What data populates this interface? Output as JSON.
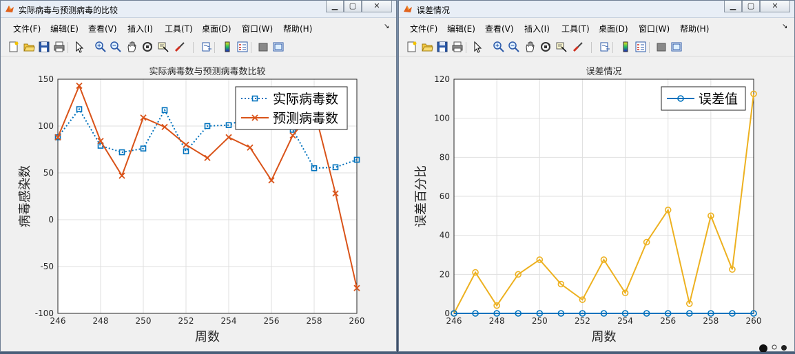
{
  "colors": {
    "accent_blue": "#0072bd",
    "accent_red": "#d95319",
    "accent_yellow": "#edb120",
    "grid": "#dfdfdf"
  },
  "window1": {
    "title": "实际病毒与预测病毒的比较",
    "menus": [
      "文件(F)",
      "编辑(E)",
      "查看(V)",
      "插入(I)",
      "工具(T)",
      "桌面(D)",
      "窗口(W)",
      "帮助(H)"
    ]
  },
  "window2": {
    "title": "误差情况",
    "menus": [
      "文件(F)",
      "编辑(E)",
      "查看(V)",
      "插入(I)",
      "工具(T)",
      "桌面(D)",
      "窗口(W)",
      "帮助(H)"
    ]
  },
  "toolbar_icons": [
    "new-figure-icon",
    "open-file-icon",
    "save-icon",
    "print-icon",
    "pointer-icon",
    "zoom-in-icon",
    "zoom-out-icon",
    "pan-icon",
    "rotate-icon",
    "data-cursor-icon",
    "brush-icon",
    "link-icon",
    "colorbar-icon",
    "legend-icon",
    "hide-plot-tools-icon",
    "show-plot-tools-icon"
  ],
  "chart_data": [
    {
      "type": "line",
      "title": "实际病毒数与预测病毒数比较",
      "xlabel": "周数",
      "ylabel": "病毒感染数",
      "xlim": [
        246,
        260
      ],
      "ylim": [
        -100,
        150
      ],
      "xticks": [
        "246",
        "248",
        "250",
        "252",
        "254",
        "256",
        "258",
        "260"
      ],
      "yticks": [
        "150",
        "100",
        "50",
        "0",
        "-50",
        "-100"
      ],
      "grid": true,
      "legend_position": "top-right",
      "x": [
        246,
        247,
        248,
        249,
        250,
        251,
        252,
        253,
        254,
        255,
        256,
        257,
        258,
        259,
        260
      ],
      "series": [
        {
          "name": "实际病毒数",
          "color": "#0072bd",
          "style": "dotted-square",
          "values": [
            88,
            118,
            79,
            72,
            76,
            117,
            73,
            100,
            101,
            110,
            112,
            96,
            55,
            56,
            64
          ]
        },
        {
          "name": "预测病毒数",
          "color": "#d95319",
          "style": "solid-x",
          "values": [
            88,
            143,
            84,
            47,
            109,
            99,
            80,
            66,
            88,
            77,
            42,
            90,
            118,
            28,
            -73
          ]
        }
      ]
    },
    {
      "type": "line",
      "title": "误差情况",
      "xlabel": "周数",
      "ylabel": "误差百分比",
      "xlim": [
        246,
        260
      ],
      "ylim": [
        0,
        120
      ],
      "xticks": [
        "246",
        "248",
        "250",
        "252",
        "254",
        "256",
        "258",
        "260"
      ],
      "yticks": [
        "120",
        "100",
        "80",
        "60",
        "40",
        "20",
        "0"
      ],
      "grid": true,
      "legend_position": "top-right",
      "x": [
        246,
        247,
        248,
        249,
        250,
        251,
        252,
        253,
        254,
        255,
        256,
        257,
        258,
        259,
        260
      ],
      "series": [
        {
          "name": "误差值",
          "color": "#0072bd",
          "style": "solid-circle",
          "values": [
            0,
            0,
            0,
            0,
            0,
            0,
            0,
            0,
            0,
            0,
            0,
            0,
            0,
            0,
            0
          ]
        },
        {
          "name": "",
          "color": "#edb120",
          "style": "solid-circle",
          "values": [
            0,
            21,
            4,
            20,
            27.5,
            15,
            7,
            27.5,
            10.5,
            36.5,
            53,
            5,
            50,
            22.5,
            112.5
          ]
        }
      ]
    }
  ]
}
